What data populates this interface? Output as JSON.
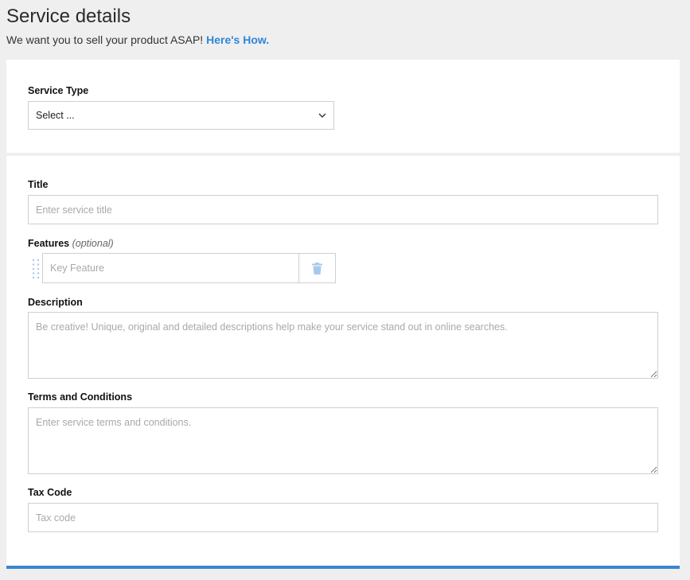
{
  "header": {
    "title": "Service details",
    "subtitle_text": "We want you to sell your product ASAP! ",
    "subtitle_link": "Here's How."
  },
  "service_type": {
    "label": "Service Type",
    "selected": "Select ..."
  },
  "form": {
    "title": {
      "label": "Title",
      "placeholder": "Enter service title"
    },
    "features": {
      "label": "Features",
      "optional_note": "(optional)",
      "placeholder": "Key Feature"
    },
    "description": {
      "label": "Description",
      "placeholder": "Be creative! Unique, original and detailed descriptions help make your service stand out in online searches."
    },
    "terms": {
      "label": "Terms and Conditions",
      "placeholder": "Enter service terms and conditions."
    },
    "tax_code": {
      "label": "Tax Code",
      "placeholder": "Tax code"
    }
  },
  "icons": {
    "select_chevron": "chevron-down-icon",
    "drag": "drag-handle-icon",
    "delete": "trash-icon"
  },
  "colors": {
    "accent": "#2f86d8",
    "bottom_bar": "#3b86d0",
    "page_background": "#efefef",
    "trash_icon": "#a7c9ee"
  }
}
